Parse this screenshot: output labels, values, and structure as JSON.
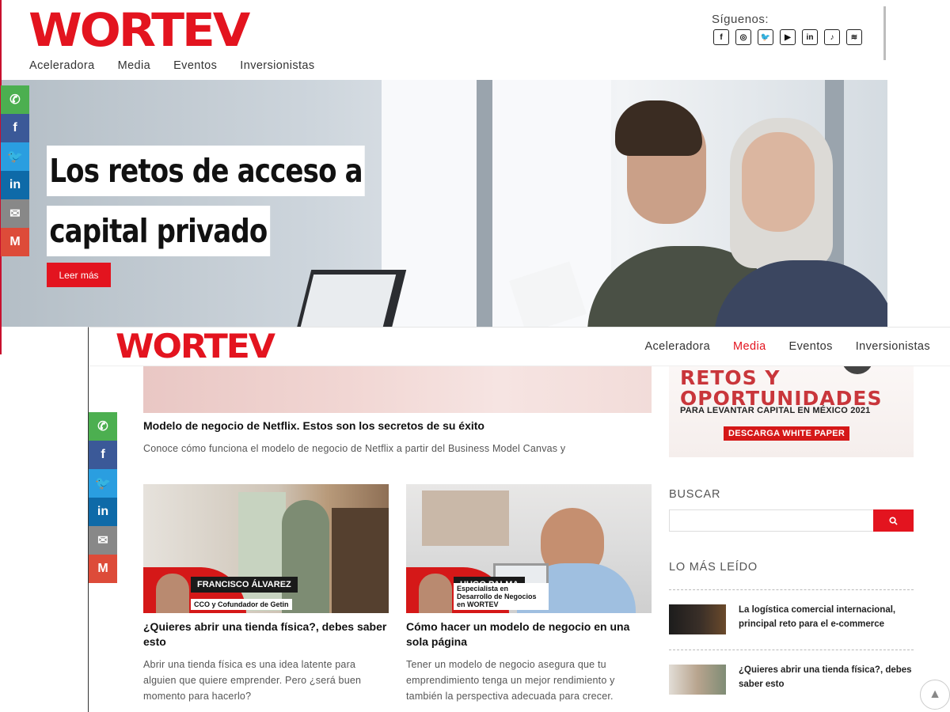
{
  "top": {
    "logo": "WORTEV",
    "nav": [
      "Aceleradora",
      "Media",
      "Eventos",
      "Inversionistas"
    ],
    "follow_label": "Síguenos:",
    "socials": [
      {
        "icon": "facebook-icon",
        "glyph": "f"
      },
      {
        "icon": "instagram-icon",
        "glyph": "◎"
      },
      {
        "icon": "twitter-icon",
        "glyph": "🐦"
      },
      {
        "icon": "youtube-icon",
        "glyph": "▶"
      },
      {
        "icon": "linkedin-icon",
        "glyph": "in"
      },
      {
        "icon": "tiktok-icon",
        "glyph": "♪"
      },
      {
        "icon": "spotify-icon",
        "glyph": "≋"
      }
    ],
    "hero": {
      "title_line1": "Los retos de acceso a",
      "title_line2": "capital privado",
      "button": "Leer más"
    }
  },
  "share": [
    {
      "icon": "whatsapp-icon",
      "glyph": "✆",
      "color": "#4caf50"
    },
    {
      "icon": "facebook-icon",
      "glyph": "f",
      "color": "#3b5998"
    },
    {
      "icon": "twitter-icon",
      "glyph": "🐦",
      "color": "#2a9ee0"
    },
    {
      "icon": "linkedin-icon",
      "glyph": "in",
      "color": "#0e6aa8"
    },
    {
      "icon": "email-icon",
      "glyph": "✉",
      "color": "#888888"
    },
    {
      "icon": "gmail-icon",
      "glyph": "M",
      "color": "#dd4b39"
    }
  ],
  "bottom": {
    "logo": "WORTEV",
    "nav": [
      "Aceleradora",
      "Media",
      "Eventos",
      "Inversionistas"
    ],
    "nav_active": "Media",
    "featured": {
      "title": "Modelo de negocio de Netflix. Estos son los secretos de su éxito",
      "excerpt": "Conoce cómo funciona el modelo de negocio de Netflix a partir del Business Model Canvas y"
    },
    "cards": [
      {
        "title": "¿Quieres abrir una tienda física?, debes saber esto",
        "excerpt": "Abrir una tienda física es una idea latente para alguien que quiere emprender. Pero ¿será buen momento para hacerlo?",
        "badge_name": "FRANCISCO ÁLVAREZ",
        "badge_role": "CCO y Cofundador de Getin"
      },
      {
        "title": "Cómo hacer un modelo de negocio en una sola página",
        "excerpt": "Tener un modelo de negocio asegura que tu emprendimiento tenga un mejor rendimiento y también la perspectiva adecuada para crecer.",
        "badge_name": "HUGO PALMA",
        "badge_role": "Especialista en Desarrollo de Negocios en WORTEV"
      }
    ],
    "promo": {
      "headline": "RETOS Y OPORTUNIDADES",
      "subline": "PARA LEVANTAR CAPITAL EN MÉXICO 2021",
      "button": "DESCARGA WHITE PAPER"
    },
    "search_title": "BUSCAR",
    "search_placeholder": "",
    "popular_title": "LO MÁS LEÍDO",
    "popular": [
      {
        "title": "La logística comercial internacional, principal reto para el e-commerce"
      },
      {
        "title": "¿Quieres abrir una tienda física?, debes saber esto"
      }
    ]
  }
}
